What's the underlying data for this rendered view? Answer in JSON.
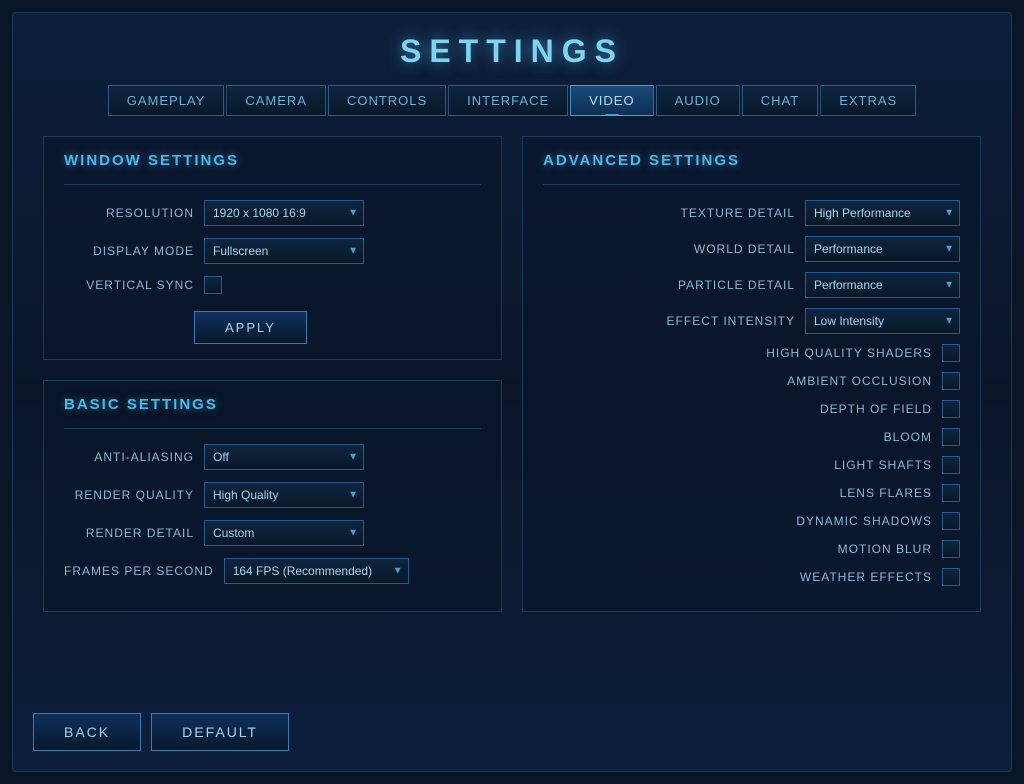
{
  "title": "SETTINGS",
  "tabs": [
    {
      "label": "GAMEPLAY",
      "active": false
    },
    {
      "label": "CAMERA",
      "active": false
    },
    {
      "label": "CONTROLS",
      "active": false
    },
    {
      "label": "INTERFACE",
      "active": false
    },
    {
      "label": "VIDEO",
      "active": true
    },
    {
      "label": "AUDIO",
      "active": false
    },
    {
      "label": "CHAT",
      "active": false
    },
    {
      "label": "EXTRAS",
      "active": false
    }
  ],
  "window_settings": {
    "title": "WINDOW SETTINGS",
    "resolution_label": "RESOLUTION",
    "resolution_value": "1920 x 1080 16:9",
    "display_mode_label": "DISPLAY MODE",
    "display_mode_value": "Fullscreen",
    "vertical_sync_label": "VERTICAL SYNC",
    "apply_label": "APPLY"
  },
  "basic_settings": {
    "title": "BASIC SETTINGS",
    "anti_aliasing_label": "ANTI-ALIASING",
    "anti_aliasing_value": "Off",
    "render_quality_label": "RENDER QUALITY",
    "render_quality_value": "High Quality",
    "render_detail_label": "RENDER DETAIL",
    "render_detail_value": "Custom",
    "fps_label": "FRAMES PER SECOND",
    "fps_value": "164  FPS (Recommended)"
  },
  "advanced_settings": {
    "title": "ADVANCED SETTINGS",
    "texture_detail_label": "TEXTURE DETAIL",
    "texture_detail_value": "High Performance",
    "world_detail_label": "WORLD DETAIL",
    "world_detail_value": "Performance",
    "particle_detail_label": "PARTICLE DETAIL",
    "particle_detail_value": "Performance",
    "effect_intensity_label": "EFFECT INTENSITY",
    "effect_intensity_value": "Low Intensity",
    "high_quality_shaders_label": "HIGH QUALITY SHADERS",
    "ambient_occlusion_label": "AMBIENT OCCLUSION",
    "depth_of_field_label": "DEPTH OF FIELD",
    "bloom_label": "BLOOM",
    "light_shafts_label": "LIGHT SHAFTS",
    "lens_flares_label": "LENS FLARES",
    "dynamic_shadows_label": "DYNAMIC SHADOWS",
    "motion_blur_label": "MOTION BLUR",
    "weather_effects_label": "WEATHER EFFECTS"
  },
  "buttons": {
    "back_label": "BACK",
    "default_label": "DEFAULT"
  }
}
